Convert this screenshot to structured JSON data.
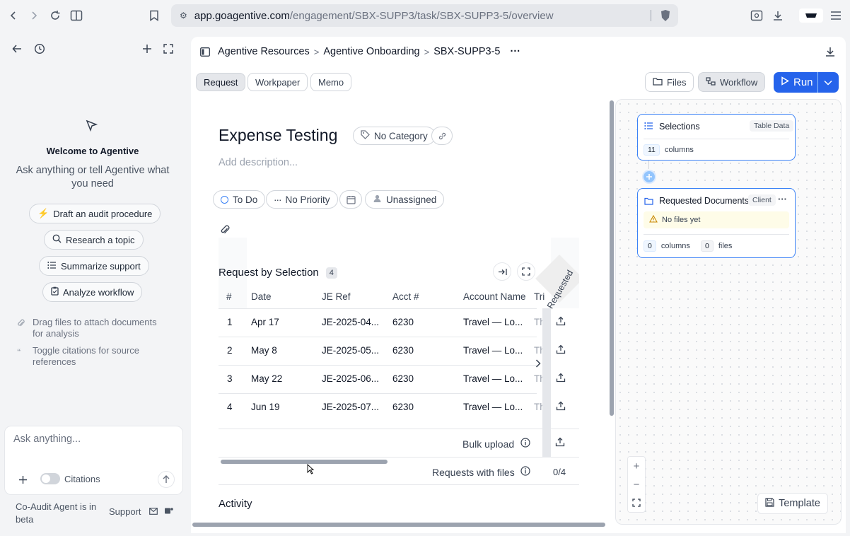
{
  "browser": {
    "url_host": "app.goagentive.com",
    "url_path": "/engagement/SBX-SUPP3/task/SBX-SUPP3-5/overview"
  },
  "chat": {
    "welcome_title": "Welcome to Agentive",
    "welcome_sub": "Ask anything or tell Agentive what you need",
    "suggestions": [
      {
        "label": "Draft an audit procedure",
        "icon": "lightning-icon"
      },
      {
        "label": "Research a topic",
        "icon": "search-icon"
      },
      {
        "label": "Summarize support",
        "icon": "list-icon"
      },
      {
        "label": "Analyze workflow",
        "icon": "clipboard-icon"
      }
    ],
    "hints": [
      {
        "text": "Drag files to attach documents for analysis",
        "icon": "paperclip-icon"
      },
      {
        "text": "Toggle citations for source references",
        "icon": "quote-icon"
      }
    ],
    "input_placeholder": "Ask anything...",
    "citations_label": "Citations",
    "beta_text": "Co-Audit Agent is in beta",
    "support_label": "Support"
  },
  "header": {
    "breadcrumb": [
      "Agentive Resources",
      "Agentive Onboarding",
      "SBX-SUPP3-5"
    ],
    "more": "···"
  },
  "tabs": [
    "Request",
    "Workpaper",
    "Memo"
  ],
  "toolbar": {
    "files_label": "Files",
    "workflow_label": "Workflow",
    "run_label": "Run"
  },
  "task": {
    "title": "Expense Testing",
    "category": "No Category",
    "description_placeholder": "Add description...",
    "status": "To Do",
    "priority": "No Priority",
    "assignee": "Unassigned"
  },
  "table": {
    "title": "Request by Selection",
    "count": "4",
    "rotated_header": "Requested Docum",
    "columns": [
      "#",
      "Date",
      "JE Ref",
      "Acct #",
      "Account Name",
      "Tri"
    ],
    "rows": [
      [
        "1",
        "Apr 17",
        "JE-2025-04...",
        "6230",
        "Travel — Lo...",
        "Th"
      ],
      [
        "2",
        "May 8",
        "JE-2025-05...",
        "6230",
        "Travel — Lo...",
        "Th"
      ],
      [
        "3",
        "May 22",
        "JE-2025-06...",
        "6230",
        "Travel — Lo...",
        "Th"
      ],
      [
        "4",
        "Jun 19",
        "JE-2025-07...",
        "6230",
        "Travel — Lo...",
        "Th"
      ]
    ],
    "bulk_upload_label": "Bulk upload",
    "requests_with_files_label": "Requests with files",
    "requests_with_files_value": "0/4"
  },
  "activity_title": "Activity",
  "workflow": {
    "node1": {
      "title": "Selections",
      "tag": "Table Data",
      "columns_count": "11",
      "columns_label": "columns"
    },
    "node2": {
      "title": "Requested Documents",
      "tag": "Client",
      "warning": "No files yet",
      "columns_count": "0",
      "columns_label": "columns",
      "files_count": "0",
      "files_label": "files"
    },
    "template_label": "Template"
  },
  "colors": {
    "accent": "#2563eb",
    "node_border": "#3b82f6"
  }
}
